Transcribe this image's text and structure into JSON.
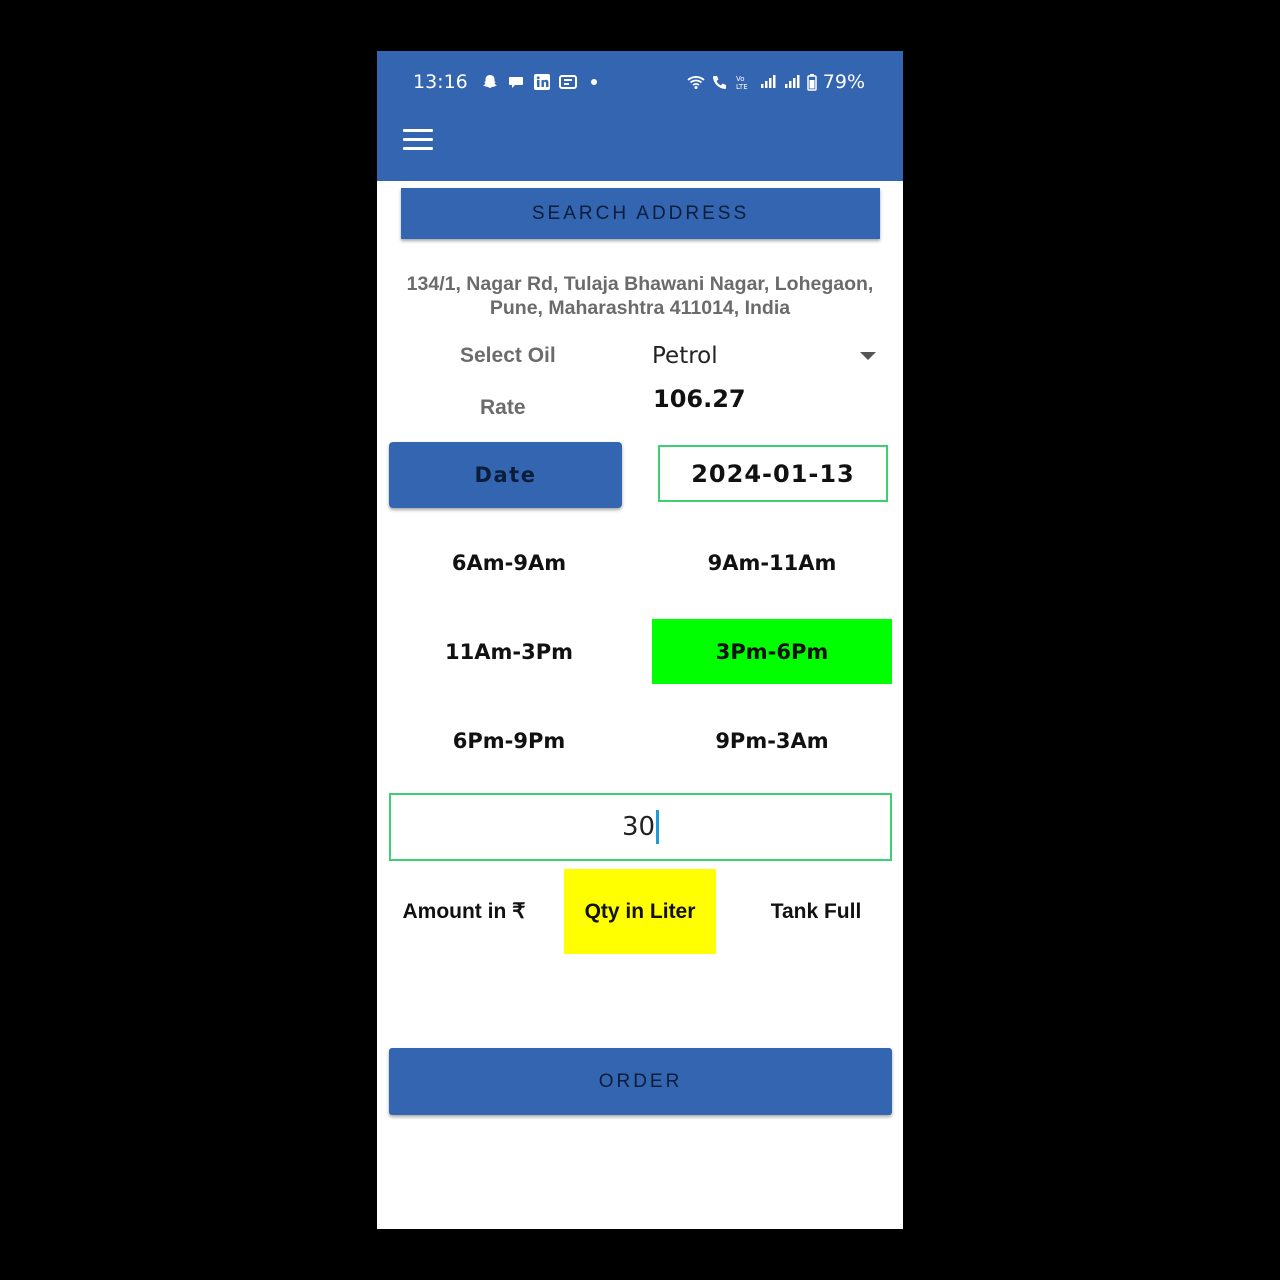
{
  "status_bar": {
    "time": "13:16",
    "battery": "79%",
    "left_icons": [
      "snapchat-icon",
      "chat-bubble-icon",
      "linkedin-icon",
      "app-icon",
      "dot-icon"
    ],
    "right_icons": [
      "wifi-icon",
      "wifi-call-icon",
      "volte-icon",
      "signal-icon",
      "signal-icon",
      "battery-icon"
    ]
  },
  "app_bar": {
    "menu_icon": "hamburger-menu-icon",
    "color": "#3465b0"
  },
  "search_button": "SEARCH ADDRESS",
  "address": "134/1, Nagar Rd, Tulaja Bhawani Nagar, Lohegaon, Pune, Maharashtra 411014, India",
  "oil": {
    "label": "Select Oil",
    "selected": "Petrol"
  },
  "rate": {
    "label": "Rate",
    "value": "106.27"
  },
  "date": {
    "button_label": "Date",
    "value": "2024-01-13"
  },
  "time_slots": [
    {
      "label": "6Am-9Am",
      "selected": false
    },
    {
      "label": "9Am-11Am",
      "selected": false
    },
    {
      "label": "11Am-3Pm",
      "selected": false
    },
    {
      "label": "3Pm-6Pm",
      "selected": true
    },
    {
      "label": "6Pm-9Pm",
      "selected": false
    },
    {
      "label": "9Pm-3Am",
      "selected": false
    }
  ],
  "quantity_input": "30",
  "modes": [
    {
      "label": "Amount in ₹",
      "selected": false
    },
    {
      "label": "Qty in Liter",
      "selected": true
    },
    {
      "label": "Tank Full",
      "selected": false
    }
  ],
  "order_button": "ORDER",
  "colors": {
    "primary": "#3465b0",
    "selected_slot": "#00ff00",
    "selected_mode": "#ffff00",
    "field_border": "#3ccf74"
  }
}
